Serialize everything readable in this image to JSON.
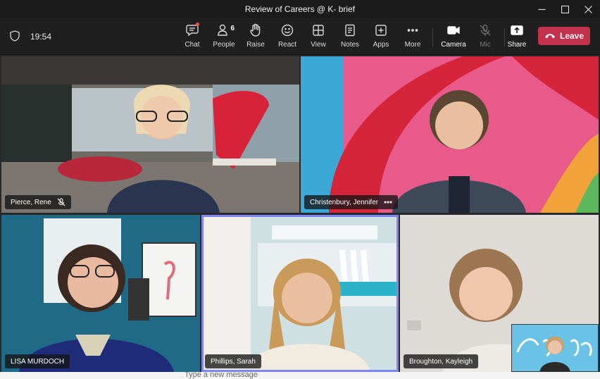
{
  "window": {
    "title": "Review of Careers @ K- brief"
  },
  "toolbar": {
    "time": "19:54",
    "items": [
      {
        "label": "Chat",
        "icon": "chat-icon"
      },
      {
        "label": "People",
        "icon": "people-icon",
        "count": "6"
      },
      {
        "label": "Raise",
        "icon": "raise-hand-icon"
      },
      {
        "label": "React",
        "icon": "react-icon"
      },
      {
        "label": "View",
        "icon": "view-icon"
      },
      {
        "label": "Notes",
        "icon": "notes-icon"
      },
      {
        "label": "Apps",
        "icon": "apps-icon"
      },
      {
        "label": "More",
        "icon": "more-icon"
      },
      {
        "label": "Camera",
        "icon": "camera-icon"
      },
      {
        "label": "Mic",
        "icon": "mic-off-icon"
      },
      {
        "label": "Share",
        "icon": "share-icon"
      }
    ],
    "leave_label": "Leave"
  },
  "participants": [
    {
      "name": "Pierce, Rene",
      "muted": true
    },
    {
      "name": "Christenbury, Jennifer",
      "has_more": true
    },
    {
      "name": "LISA MURDOCH"
    },
    {
      "name": "Phillips, Sarah",
      "active_speaker": true
    },
    {
      "name": "Broughton, Kayleigh"
    }
  ],
  "compose": {
    "placeholder": "Type a new message"
  },
  "colors": {
    "leave_red": "#c4314b",
    "active_speaker_border": "#7f85f5",
    "notification_dot": "#e8564f"
  }
}
